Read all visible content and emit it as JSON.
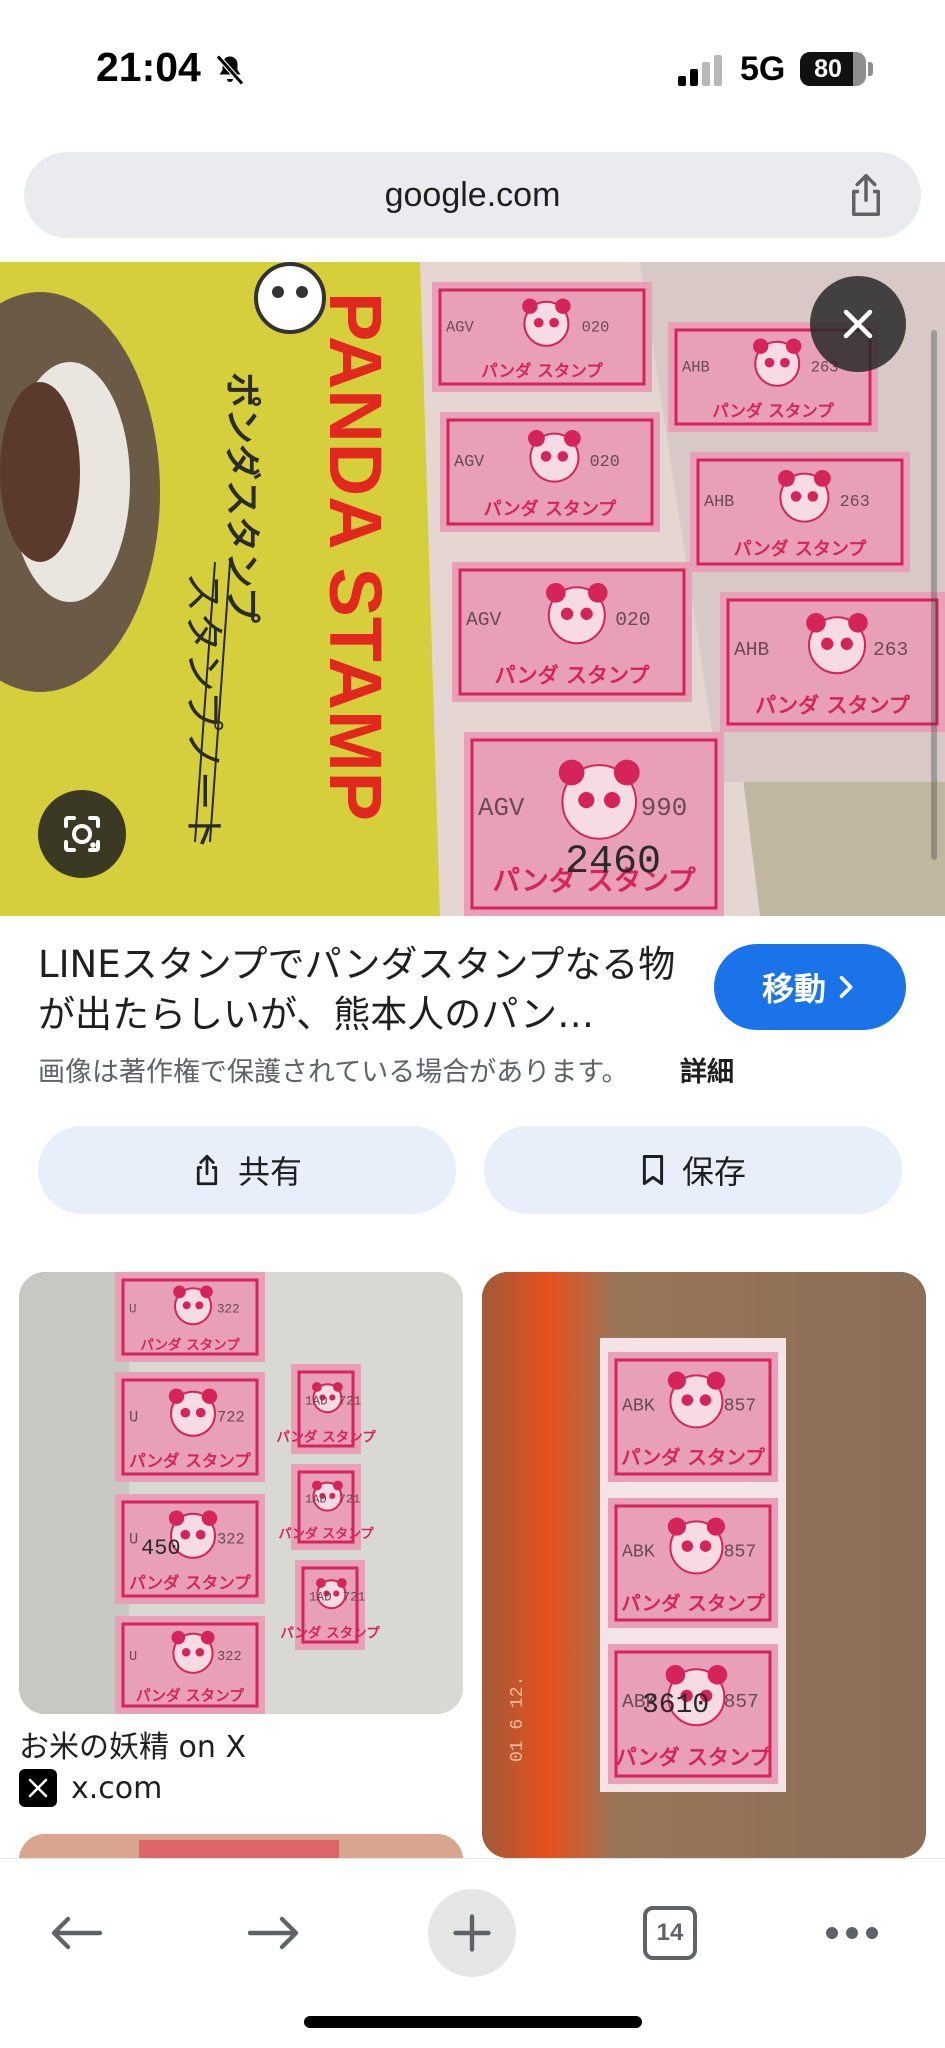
{
  "status_bar": {
    "time": "21:04",
    "network": "5G",
    "battery_level": "80",
    "battery_fraction": 0.8,
    "icons": [
      "bell-off-icon",
      "signal-icon",
      "battery-icon"
    ]
  },
  "browser": {
    "url": "google.com"
  },
  "hero": {
    "image_text_title": "PANDA STAMP",
    "image_text_brand": "ポンダスタンプ",
    "image_text_note": "スタンプノート",
    "stamp_label": "パンダ スタンプ",
    "stamp_codes": [
      "AGV",
      "AHB"
    ],
    "stamp_numbers": [
      "020",
      "263",
      "990",
      "2460"
    ]
  },
  "result": {
    "title": "LINEスタンプでパンダスタンプなる物が出たらしいが、熊本人のパン…",
    "visit_label": "移動",
    "copyright_note": "画像は著作権で保護されている場合があります。",
    "details_label": "詳細",
    "share_label": "共有",
    "save_label": "保存"
  },
  "grid": {
    "card_left": {
      "title": "お米の妖精 on X",
      "source": "x.com",
      "stamp_label": "パンダ スタンプ",
      "codes": [
        "U",
        "1AD"
      ],
      "numbers": [
        "322",
        "722",
        "721",
        "450"
      ]
    },
    "card_right": {
      "stamp_label": "パンダ スタンプ",
      "code": "ABK",
      "numbers": [
        "857",
        "3610"
      ],
      "date_stamp": "01 6 12."
    }
  },
  "toolbar": {
    "tab_count": "14"
  },
  "colors": {
    "accent": "#1a73e8",
    "pill_bg": "#e8effa",
    "url_bar_bg": "#e9ebee",
    "stamp_pink": "#e8a0b8",
    "stamp_red": "#d4245a"
  }
}
